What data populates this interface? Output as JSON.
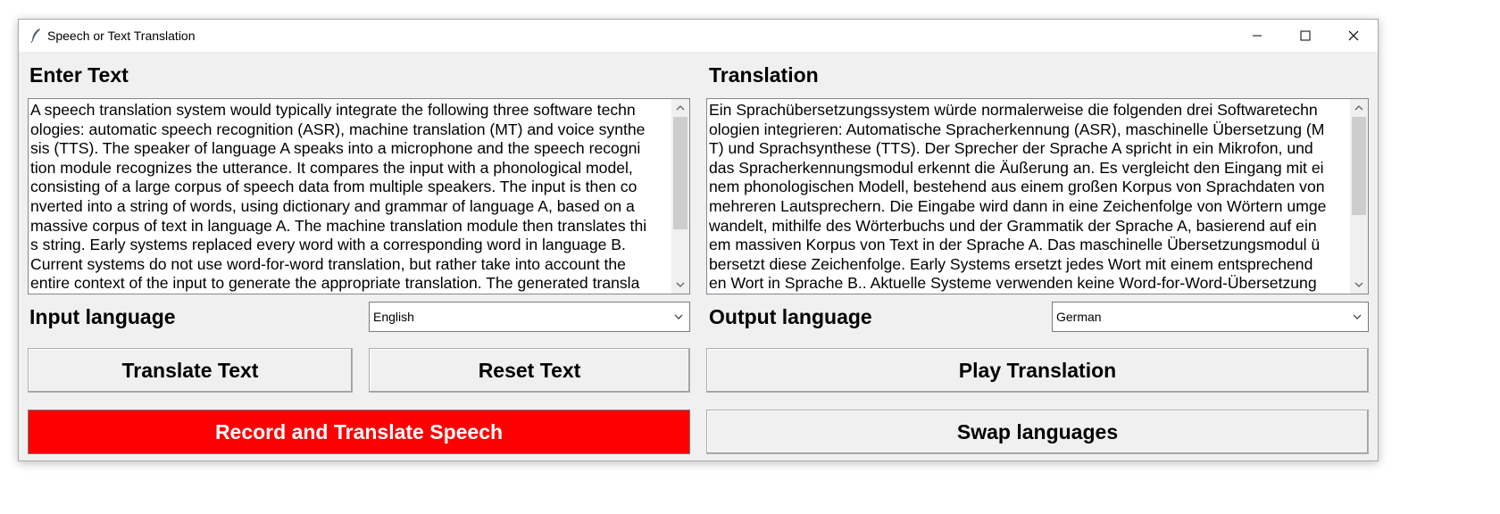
{
  "window": {
    "title": "Speech or Text Translation"
  },
  "input_panel": {
    "heading": "Enter Text",
    "lines": [
      "A speech translation system would typically integrate the following three software techn",
      "ologies: automatic speech recognition (ASR), machine translation (MT) and voice synthe",
      "sis (TTS). The speaker of language A speaks into a microphone and the speech recogni",
      "tion module recognizes the utterance. It compares the input with a phonological model,",
      "consisting of a large corpus of speech data from multiple speakers. The input is then co",
      "nverted into a string of words, using dictionary and grammar of language A, based on a",
      "massive corpus of text in language A. The machine translation module then translates thi",
      "s string. Early systems replaced every word with a corresponding word in language B.",
      "Current systems do not use word-for-word translation, but rather take into account the",
      "entire context of the input to generate the appropriate translation. The generated transla"
    ],
    "language_label": "Input language",
    "language_value": "English"
  },
  "output_panel": {
    "heading": "Translation",
    "lines": [
      "Ein Sprachübersetzungssystem würde normalerweise die folgenden drei Softwaretechn",
      "ologien integrieren: Automatische Spracherkennung (ASR), maschinelle Übersetzung (M",
      "T) und Sprachsynthese (TTS). Der Sprecher der Sprache A spricht in ein Mikrofon, und",
      "das Spracherkennungsmodul erkennt die Äußerung an. Es vergleicht den Eingang mit ei",
      "nem phonologischen Modell, bestehend aus einem großen Korpus von Sprachdaten von",
      "mehreren Lautsprechern. Die Eingabe wird dann in eine Zeichenfolge von Wörtern umge",
      "wandelt, mithilfe des Wörterbuchs und der Grammatik der Sprache A, basierend auf ein",
      "em massiven Korpus von Text in der Sprache A. Das maschinelle Übersetzungsmodul ü",
      "bersetzt diese Zeichenfolge. Early Systems ersetzt jedes Wort mit einem entsprechend",
      "en Wort in Sprache B.. Aktuelle Systeme verwenden keine Word-for-Word-Übersetzung"
    ],
    "language_label": "Output language",
    "language_value": "German"
  },
  "buttons": {
    "translate_text": "Translate Text",
    "reset_text": "Reset Text",
    "play_translation": "Play Translation",
    "record_translate": "Record and Translate Speech",
    "swap_languages": "Swap languages"
  },
  "icons": {
    "app": "feather-icon",
    "minimize": "minimize-icon",
    "maximize": "maximize-icon",
    "close": "close-icon"
  },
  "colors": {
    "record_button_bg": "#ff0000",
    "record_button_text": "#ffffff",
    "window_bg": "#f0f0f0"
  }
}
